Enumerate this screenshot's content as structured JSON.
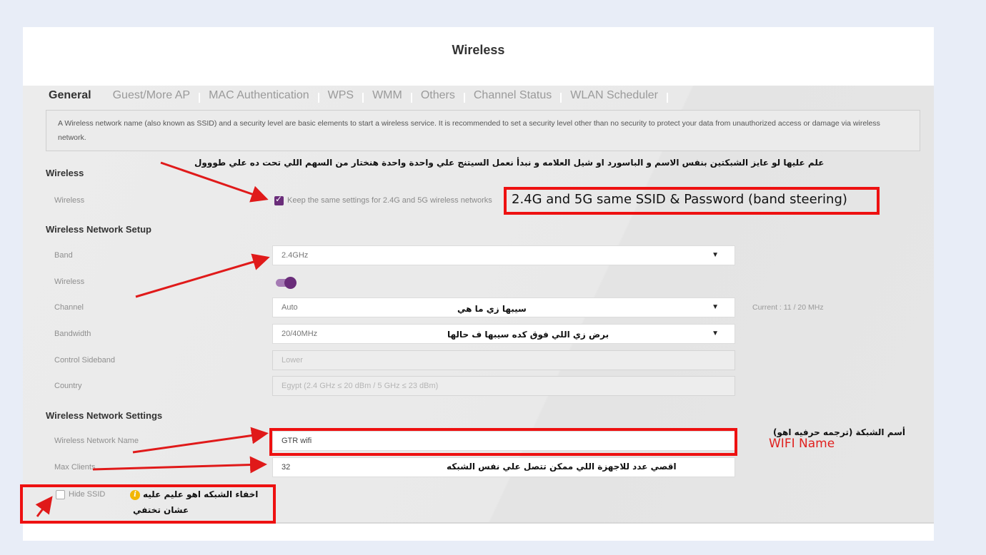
{
  "page": {
    "title": "Wireless"
  },
  "tabs": [
    {
      "label": "General",
      "active": true
    },
    {
      "label": "Guest/More AP",
      "active": false
    },
    {
      "label": "MAC Authentication",
      "active": false
    },
    {
      "label": "WPS",
      "active": false
    },
    {
      "label": "WMM",
      "active": false
    },
    {
      "label": "Others",
      "active": false
    },
    {
      "label": "Channel Status",
      "active": false
    },
    {
      "label": "WLAN Scheduler",
      "active": false
    }
  ],
  "info_text": "A Wireless network name (also known as SSID) and a security level are basic elements to start a wireless service. It is recommended to set a security level other than no security to protect your data from unauthorized access or damage via wireless network.",
  "sections": {
    "wireless": {
      "title": "Wireless",
      "wireless_label": "Wireless",
      "same_settings_label": "Keep the same settings for 2.4G and 5G wireless networks",
      "same_settings_checked": true
    },
    "setup": {
      "title": "Wireless Network Setup",
      "band_label": "Band",
      "band_value": "2.4GHz",
      "wireless_label": "Wireless",
      "wireless_enabled": true,
      "channel_label": "Channel",
      "channel_value": "Auto",
      "channel_current": "Current : 11 / 20 MHz",
      "bandwidth_label": "Bandwidth",
      "bandwidth_value": "20/40MHz",
      "sideband_label": "Control Sideband",
      "sideband_value": "Lower",
      "country_label": "Country",
      "country_value": "Egypt (2.4 GHz ≤ 20 dBm / 5 GHz ≤ 23 dBm)"
    },
    "settings": {
      "title": "Wireless Network Settings",
      "name_label": "Wireless Network Name",
      "name_value": "GTR wifi",
      "max_label": "Max Clients",
      "max_value": "32",
      "hide_ssid_label": "Hide SSID",
      "hide_ssid_checked": false
    }
  },
  "annotations": {
    "top_ar": "علم عليها لو عايز الشبكتين بنفس الاسم و الباسورد او شيل العلامه و نبدأ نعمل السيتنج علي واحدة واحدة هنختار من السهم اللي تحت ده علي طووول",
    "band_steering": "2.4G and 5G same SSID & Password (band steering)",
    "channel_ar": "سيبها زي ما هي",
    "bandwidth_ar": "برض زي اللي فوق كده سيبها  ف حالها",
    "name_ar": "أسم الشبكة (ترجمه حرفيه اهو)",
    "wifi_name": "WIFI Name",
    "max_ar": "اقصي عدد للاجهزة اللي ممكن تتصل علي نفس الشبكه",
    "hide_ar_1": "اخفاء الشبكه اهو عليم عليه",
    "hide_ar_2": "عشان تختفي",
    "info_icon_glyph": "i"
  },
  "colors": {
    "accent": "#6a2d7a",
    "annotation_red": "#ee1111"
  }
}
